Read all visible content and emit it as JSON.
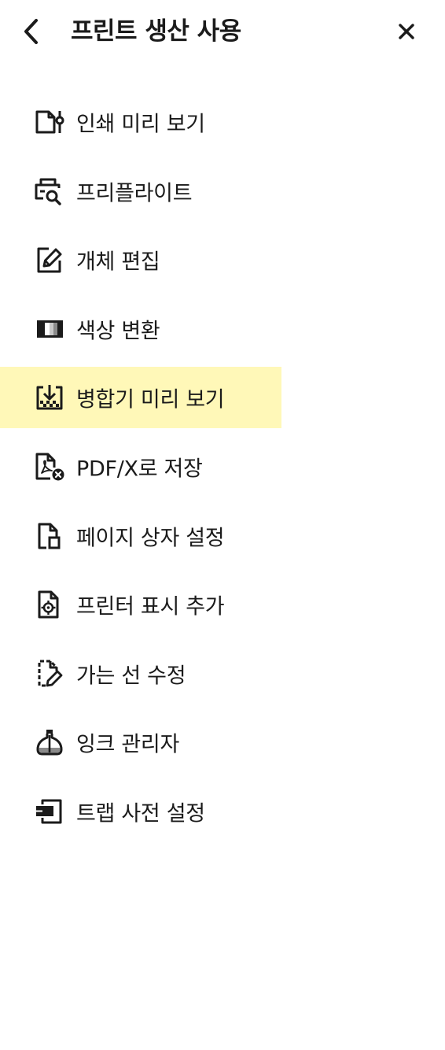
{
  "header": {
    "title": "프린트 생산 사용",
    "back_icon": "chevron-left-icon",
    "close_icon": "close-icon"
  },
  "menu": {
    "selected_index": 4,
    "highlight_color": "#fff8b8",
    "items": [
      {
        "label": "인쇄 미리 보기",
        "icon": "print-preview-icon"
      },
      {
        "label": "프리플라이트",
        "icon": "preflight-icon"
      },
      {
        "label": "개체 편집",
        "icon": "edit-object-icon"
      },
      {
        "label": "색상 변환",
        "icon": "convert-colors-icon"
      },
      {
        "label": "병합기 미리 보기",
        "icon": "flattener-preview-icon"
      },
      {
        "label": "PDF/X로 저장",
        "icon": "save-as-pdfx-icon"
      },
      {
        "label": "페이지 상자 설정",
        "icon": "set-page-boxes-icon"
      },
      {
        "label": "프린터 표시 추가",
        "icon": "add-printer-marks-icon"
      },
      {
        "label": "가는 선 수정",
        "icon": "fix-hairlines-icon"
      },
      {
        "label": "잉크 관리자",
        "icon": "ink-manager-icon"
      },
      {
        "label": "트랩 사전 설정",
        "icon": "trap-presets-icon"
      }
    ]
  }
}
